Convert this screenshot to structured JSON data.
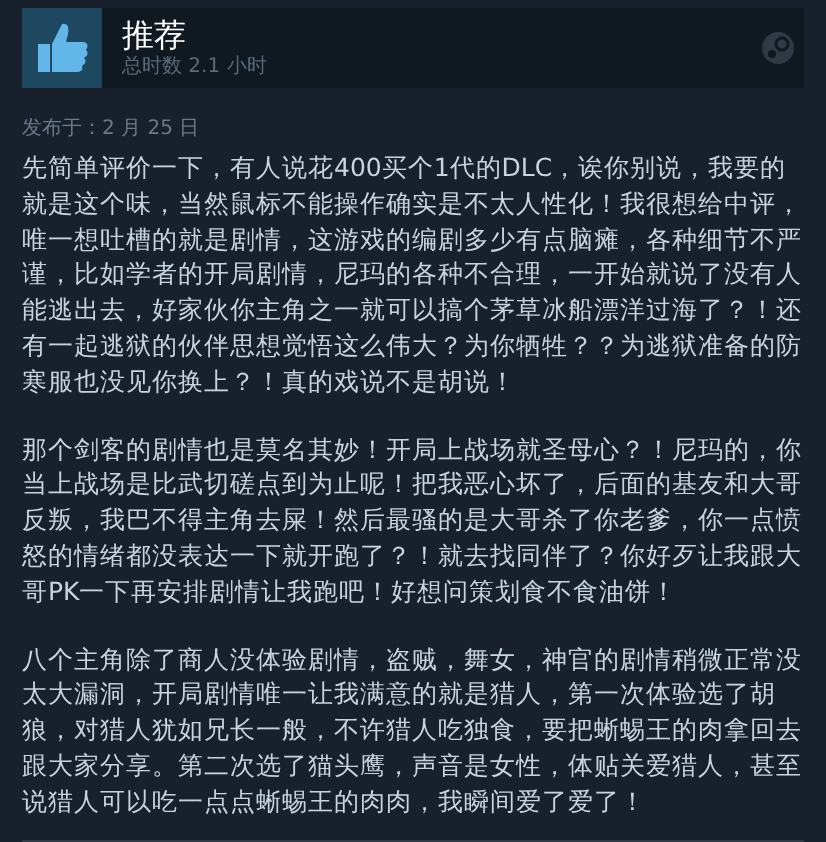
{
  "review": {
    "verdict": "推荐",
    "playtime": "总时数 2.1 小时",
    "posted": "发布于：2 月 25 日",
    "paragraphs": [
      "先简单评价一下，有人说花400买个1代的DLC，诶你别说，我要的就是这个味，当然鼠标不能操作确实是不太人性化！我很想给中评，唯一想吐槽的就是剧情，这游戏的编剧多少有点脑瘫，各种细节不严谨，比如学者的开局剧情，尼玛的各种不合理，一开始就说了没有人能逃出去，好家伙你主角之一就可以搞个茅草冰船漂洋过海了？！还有一起逃狱的伙伴思想觉悟这么伟大？为你牺牲？？为逃狱准备的防寒服也没见你换上？！真的戏说不是胡说！",
      "那个剑客的剧情也是莫名其妙！开局上战场就圣母心？！尼玛的，你当上战场是比武切磋点到为止呢！把我恶心坏了，后面的基友和大哥反叛，我巴不得主角去屎！然后最骚的是大哥杀了你老爹，你一点愤怒的情绪都没表达一下就开跑了？！就去找同伴了？你好歹让我跟大哥PK一下再安排剧情让我跑吧！好想问策划食不食油饼！",
      "八个主角除了商人没体验剧情，盗贼，舞女，神官的剧情稍微正常没太大漏洞，开局剧情唯一让我满意的就是猎人，第一次体验选了胡狼，对猎人犹如兄长一般，不许猎人吃独食，要把蜥蜴王的肉拿回去跟大家分享。第二次选了猫头鹰，声音是女性，体贴关爱猎人，甚至说猎人可以吃一点点蜥蜴王的肉肉，我瞬间爱了爱了！"
    ]
  }
}
